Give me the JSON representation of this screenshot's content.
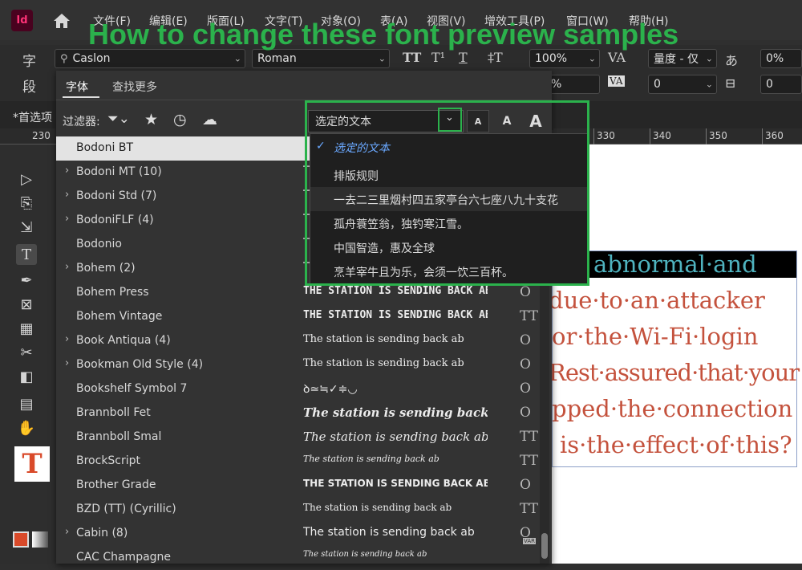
{
  "app": {
    "logo_text": "Id"
  },
  "headline": "How to change these font preview samples",
  "menu": [
    "文件(F)",
    "编辑(E)",
    "版面(L)",
    "文字(T)",
    "对象(O)",
    "表(A)",
    "视图(V)",
    "增效工具(P)",
    "窗口(W)",
    "帮助(H)"
  ],
  "control_bar": {
    "char_label": "字",
    "para_label": "段",
    "font_family": "Caslon",
    "font_style": "Roman",
    "scale_value": "100%",
    "metrics_label": "量度 - 仅",
    "tracking_value": "0%",
    "percent_value": "%",
    "kerning_value": "0",
    "baseline_value": "0"
  },
  "tab_strip": {
    "doc_tab": "*首选项"
  },
  "ruler": [
    "230",
    "330",
    "340",
    "350",
    "360"
  ],
  "font_panel": {
    "tabs": [
      "字体",
      "查找更多"
    ],
    "filter_label": "过滤器:",
    "sample_select": {
      "value": "选定的文本",
      "options": [
        "选定的文本",
        "排版规则",
        "一去二三里烟村四五家亭台六七座八九十支花",
        "孤舟蓑笠翁，独钓寒江雪。",
        "中国智造，惠及全球",
        "烹羊宰牛且为乐，会须一饮三百杯。"
      ]
    },
    "size_buttons": [
      "A",
      "A",
      "A"
    ],
    "fonts": [
      {
        "name": "Bodoni BT",
        "group": false,
        "sample": "T",
        "icon": ""
      },
      {
        "name": "Bodoni MT (10)",
        "group": true,
        "sample": "T",
        "icon": ""
      },
      {
        "name": "Bodoni Std (7)",
        "group": true,
        "sample": "T",
        "icon": ""
      },
      {
        "name": "BodoniFLF (4)",
        "group": true,
        "sample": "T",
        "icon": ""
      },
      {
        "name": "Bodonio",
        "group": false,
        "sample": "T",
        "icon": ""
      },
      {
        "name": "Bohem (2)",
        "group": true,
        "sample": "T",
        "icon": ""
      },
      {
        "name": "Bohem Press",
        "group": false,
        "sample": "THE STATION IS SENDING BACK AB",
        "icon": "O"
      },
      {
        "name": "Bohem Vintage",
        "group": false,
        "sample": "THE STATION IS SENDING BACK AB",
        "icon": "TT"
      },
      {
        "name": "Book Antiqua (4)",
        "group": true,
        "sample": "The station is sending back ab",
        "icon": "O"
      },
      {
        "name": "Bookman Old Style (4)",
        "group": true,
        "sample": "The station is sending back ab",
        "icon": "O"
      },
      {
        "name": "Bookshelf Symbol 7",
        "group": false,
        "sample": "ꝺ≃≒✓≑◡",
        "icon": "O"
      },
      {
        "name": "Brannboll Fet",
        "group": false,
        "sample": "The station is sending back a",
        "icon": "O"
      },
      {
        "name": "Brannboll Smal",
        "group": false,
        "sample": "The station is sending back ab",
        "icon": "TT"
      },
      {
        "name": "BrockScript",
        "group": false,
        "sample": "The station is sending back ab",
        "icon": "TT"
      },
      {
        "name": "Brother Grade",
        "group": false,
        "sample": "THE STATION IS SENDING BACK AB",
        "icon": "O"
      },
      {
        "name": "BZD (TT) (Cyrillic)",
        "group": false,
        "sample": "The station is sending back ab",
        "icon": "TT"
      },
      {
        "name": "Cabin (8)",
        "group": true,
        "sample": "The station is sending back ab",
        "icon": "O"
      },
      {
        "name": "CAC Champagne",
        "group": false,
        "sample": "The station is sending back ab",
        "icon": "TT"
      }
    ],
    "var_badge": "VAR"
  },
  "document": {
    "lines": [
      "abnormal·and",
      "due·to·an·attacker",
      "or·the·Wi-Fi·login",
      "Rest·assured·that·your",
      "pped·the·connection",
      "is·the·effect·of·this?"
    ],
    "band_color": "#000000",
    "heading_color": "#4fb3bf",
    "body_color": "#c4523d"
  },
  "colors": {
    "accent_green": "#2bb24c"
  }
}
